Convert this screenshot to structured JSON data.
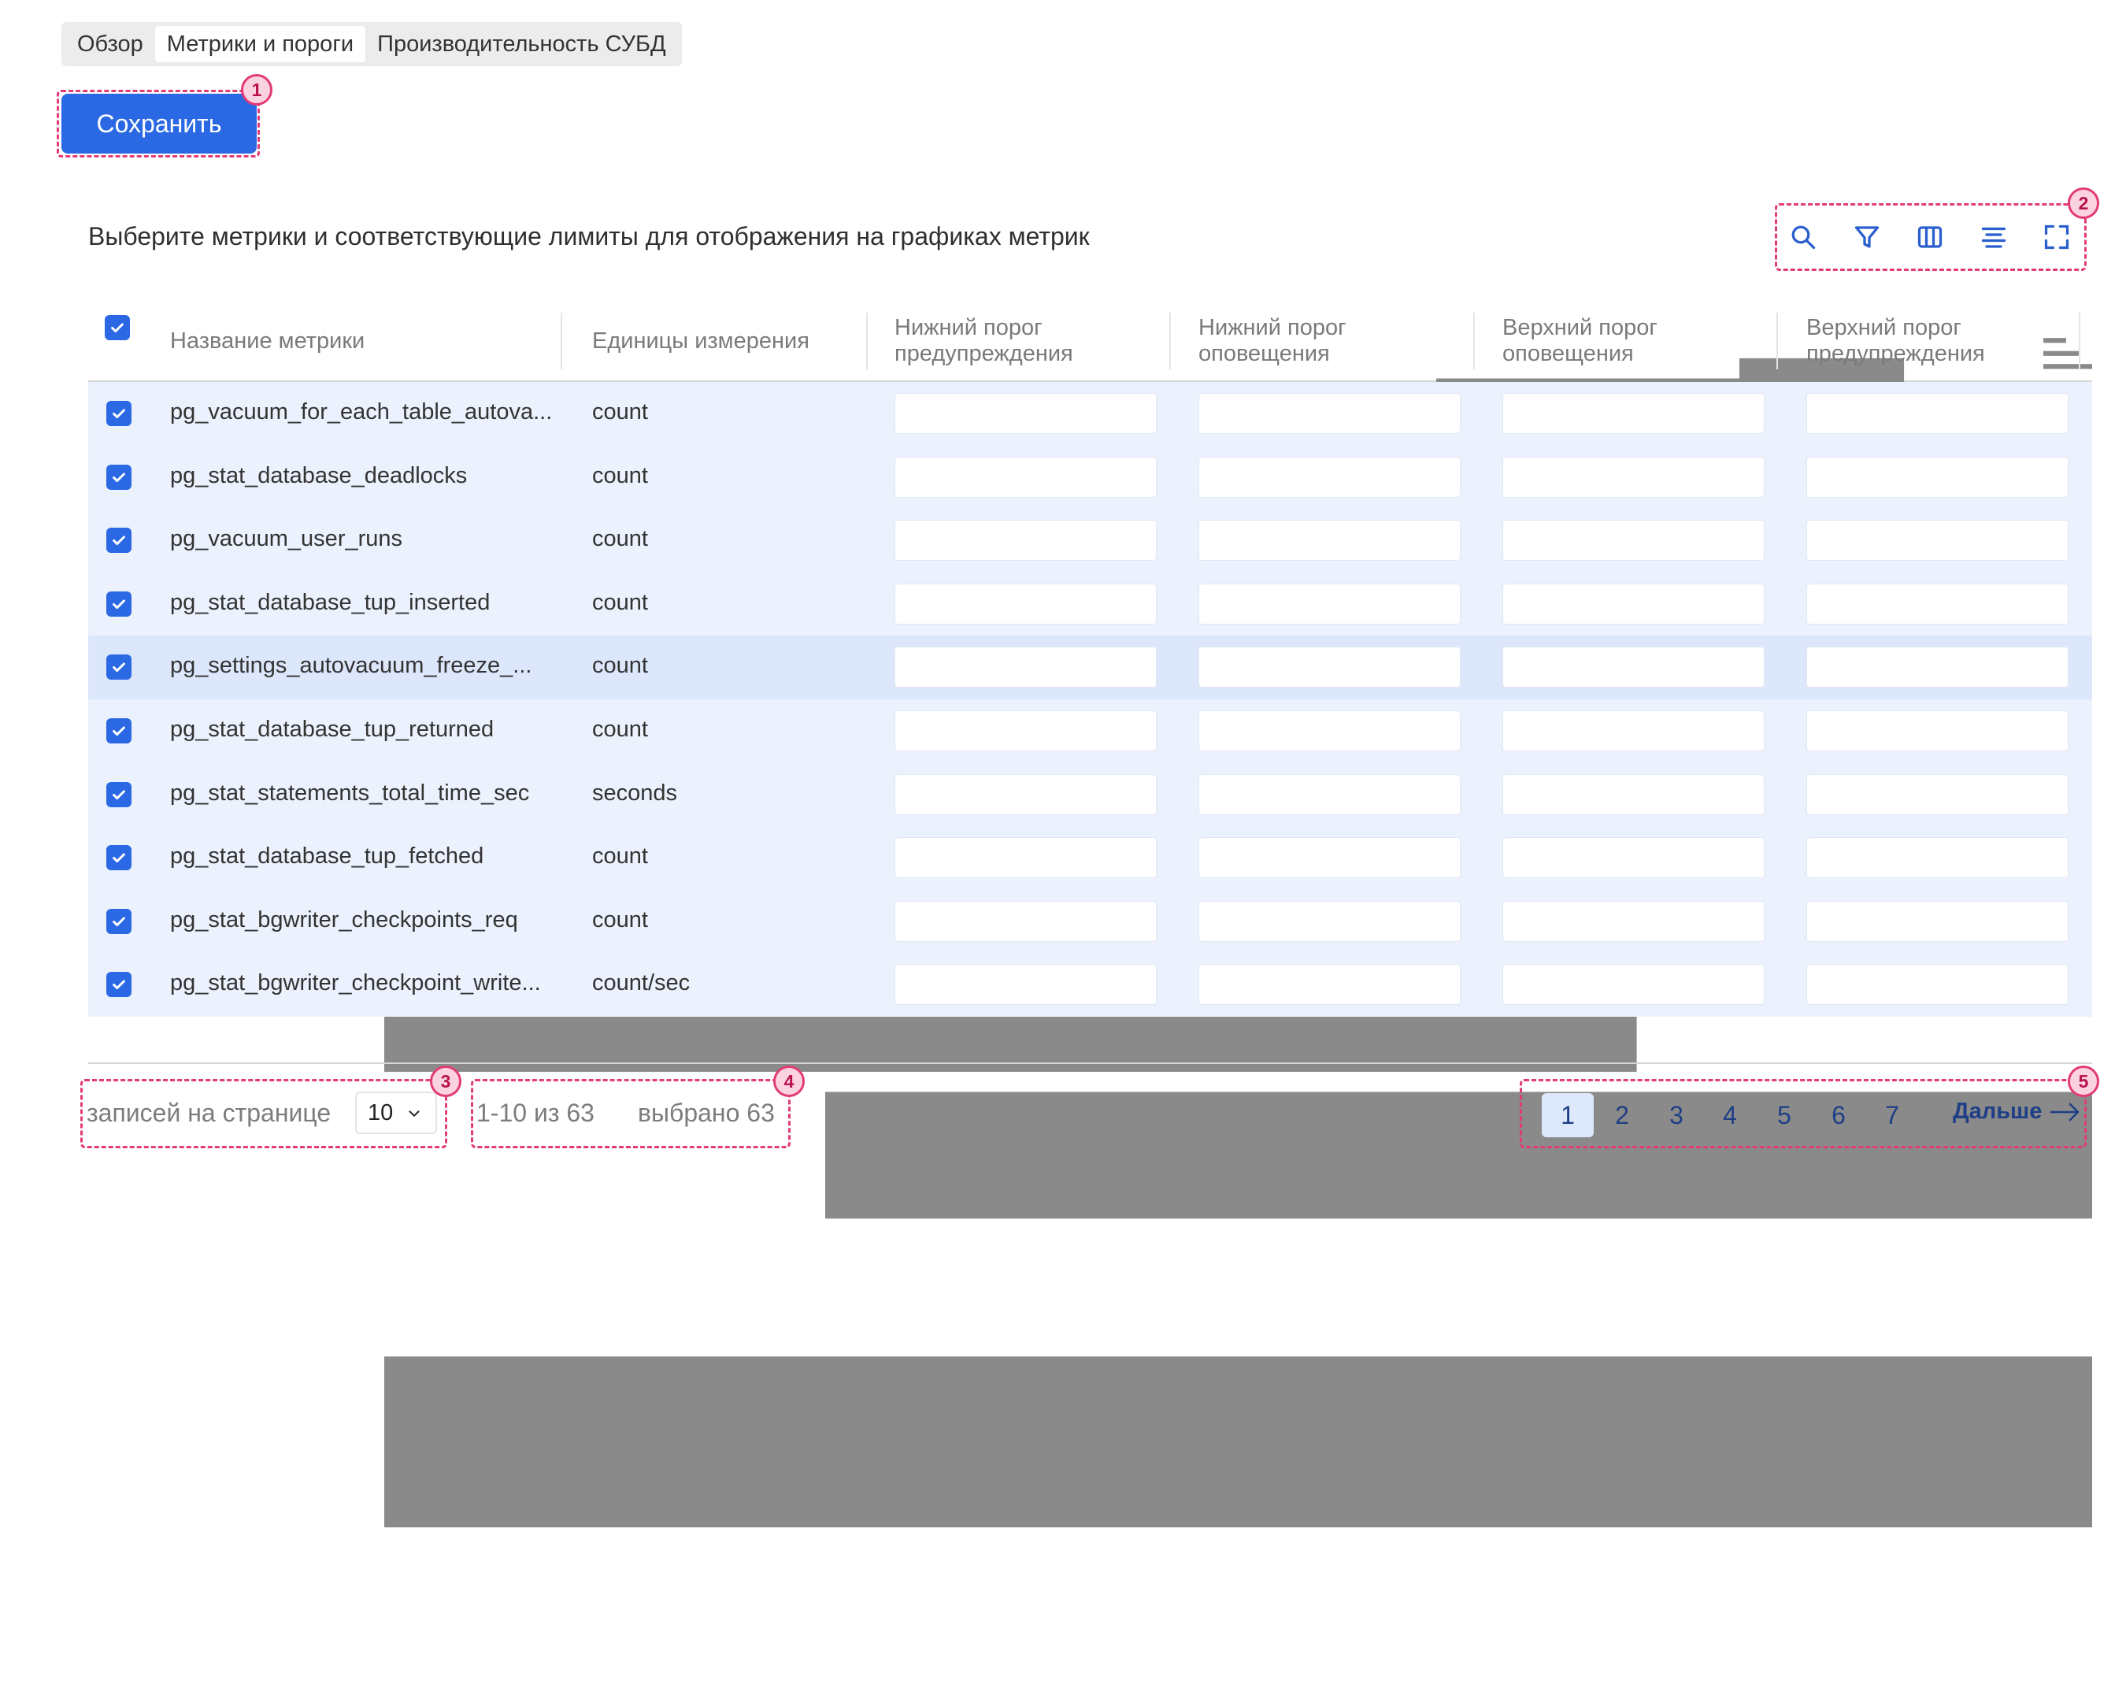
{
  "tabs": [
    {
      "label": "Обзор",
      "active": false
    },
    {
      "label": "Метрики и пороги",
      "active": true
    },
    {
      "label": "Производительность СУБД",
      "active": false
    }
  ],
  "save_button": {
    "label": "Сохранить"
  },
  "callouts": [
    "1",
    "2",
    "3",
    "4",
    "5"
  ],
  "description": "Выберите метрики и соответствующие лимиты для отображения на графиках метрик",
  "toolbar": {
    "icons": [
      "search-icon",
      "filter-icon",
      "columns-icon",
      "align-icon",
      "fullscreen-icon"
    ]
  },
  "table": {
    "select_all_checked": true,
    "columns": [
      {
        "label": "Название метрики"
      },
      {
        "label": "Единицы измерения"
      },
      {
        "label": "Нижний порог предупреждения"
      },
      {
        "label": "Нижний порог оповещения"
      },
      {
        "label": "Верхний порог оповещения"
      },
      {
        "label": "Верхний порог предупреждения"
      }
    ],
    "rows": [
      {
        "name": "pg_vacuum_for_each_table_autova...",
        "unit": "count",
        "checked": true
      },
      {
        "name": "pg_stat_database_deadlocks",
        "unit": "count",
        "checked": true
      },
      {
        "name": "pg_vacuum_user_runs",
        "unit": "count",
        "checked": true
      },
      {
        "name": "pg_stat_database_tup_inserted",
        "unit": "count",
        "checked": true
      },
      {
        "name": "pg_settings_autovacuum_freeze_...",
        "unit": "count",
        "checked": true,
        "highlighted": true
      },
      {
        "name": "pg_stat_database_tup_returned",
        "unit": "count",
        "checked": true
      },
      {
        "name": "pg_stat_statements_total_time_sec",
        "unit": "seconds",
        "checked": true
      },
      {
        "name": "pg_stat_database_tup_fetched",
        "unit": "count",
        "checked": true
      },
      {
        "name": "pg_stat_bgwriter_checkpoints_req",
        "unit": "count",
        "checked": true
      },
      {
        "name": "pg_stat_bgwriter_checkpoint_write...",
        "unit": "count/sec",
        "checked": true
      }
    ]
  },
  "footer": {
    "per_page_label": "записей на странице",
    "per_page_value": "10",
    "range_text": "1-10 из 63",
    "selected_text": "выбрано 63",
    "pages": [
      "1",
      "2",
      "3",
      "4",
      "5",
      "6",
      "7"
    ],
    "current_page": "1",
    "next_label": "Дальше"
  },
  "colors": {
    "accent": "#2b69e4",
    "callout": "#e23b77",
    "row_bg": "#ebf1fd",
    "row_highlight": "#dce7fb"
  }
}
